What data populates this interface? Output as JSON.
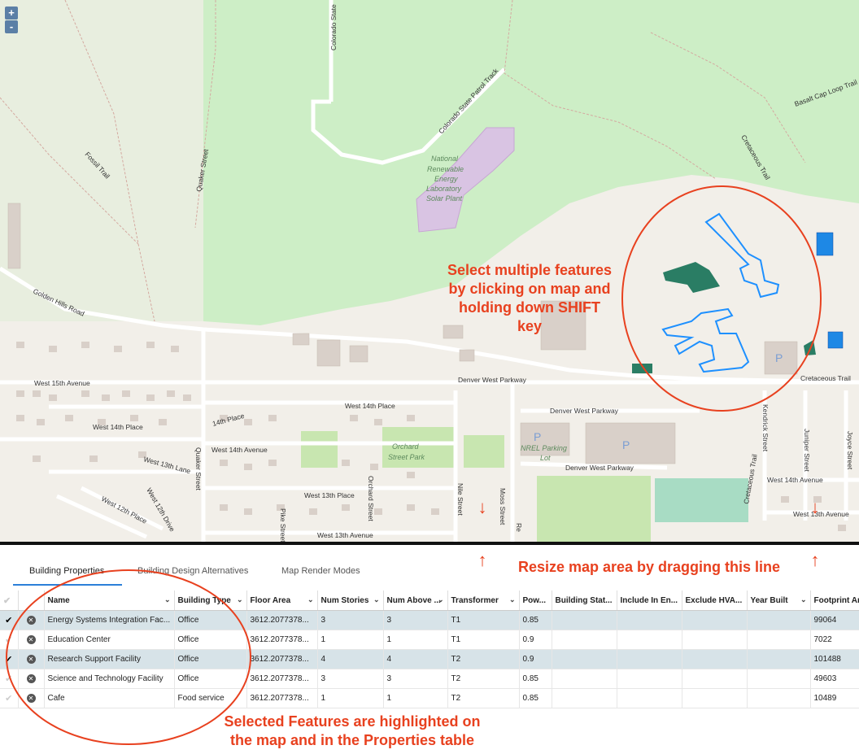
{
  "map": {
    "zoom_in": "+",
    "zoom_out": "-",
    "labels": {
      "colorado_state": "Colorado State",
      "patrol_track": "Colorado State Patrol Track",
      "basalt": "Basalt Cap Loop Trail",
      "cretaceous_trail": "Cretaceous Trail",
      "fossil_trail": "Fossil Trail",
      "quaker_street": "Quaker Street",
      "nrel_line1": "National",
      "nrel_line2": "Renewable",
      "nrel_line3": "Energy",
      "nrel_line4": "Laboratory",
      "nrel_line5": "Solar Plant",
      "golden_hills": "Golden Hills Road",
      "west_15th": "West 15th Avenue",
      "denver_west_pkwy": "Denver West Parkway",
      "cretaceous_trail_2": "Cretaceous Trail",
      "west_14th_place": "West 14th Place",
      "west_14th_place_2": "West 14th Place",
      "fourteenth_place": "14th Place",
      "west_14th_avenue": "West 14th Avenue",
      "west_13th_lane": "West 13th Lane",
      "quaker_street_2": "Quaker Street",
      "west_12th_drive": "West 12th Drive",
      "west_12th_place": "West 12th Place",
      "orchard_park_1": "Orchard",
      "orchard_park_2": "Street Park",
      "orchard_street": "Orchard Street",
      "west_13th_place": "West 13th Place",
      "nile_street": "Nile Street",
      "moss_street": "Moss Street",
      "pike_street": "Pike Street",
      "west_13th_avenue": "West 13th Avenue",
      "dwp_2": "Denver West Parkway",
      "dwp_3": "Denver West Parkway",
      "nrel_parking_1": "NREL Parking",
      "nrel_parking_2": "Lot",
      "parking": "P",
      "kendrick": "Kendrick Street",
      "juniper": "Juniper Street",
      "joyce": "Joyce Street",
      "cretaceous_trail_3": "Cretaceous Trail",
      "west_14th_avenue_2": "West 14th Avenue",
      "west_13th_avenue_2": "West 13th Avenue",
      "re": "Re"
    }
  },
  "annotations": {
    "select_line1": "Select multiple features",
    "select_line2": "by clicking on map and",
    "select_line3": "holding down SHIFT",
    "select_line4": "key",
    "resize": "Resize map area by dragging this line",
    "selected_line1": "Selected Features are highlighted on",
    "selected_line2": "the map and in the Properties table"
  },
  "tabs": {
    "building_properties": "Building Properties",
    "design_alternatives": "Building Design Alternatives",
    "render_modes": "Map Render Modes"
  },
  "table": {
    "columns": [
      "Name",
      "Building Type",
      "Floor Area",
      "Num Stories",
      "Num Above ...",
      "Transformer",
      "Pow...",
      "Building Stat...",
      "Include In En...",
      "Exclude HVA...",
      "Year Built",
      "Footprint Ar"
    ],
    "rows": [
      {
        "selected": true,
        "name": "Energy Systems Integration Fac...",
        "type": "Office",
        "floor_area": "3612.2077378...",
        "stories": "3",
        "above": "3",
        "transformer": "T1",
        "power": "0.85",
        "footprint": "99064"
      },
      {
        "selected": false,
        "name": "Education Center",
        "type": "Office",
        "floor_area": "3612.2077378...",
        "stories": "1",
        "above": "1",
        "transformer": "T1",
        "power": "0.9",
        "footprint": "7022"
      },
      {
        "selected": true,
        "name": "Research Support Facility",
        "type": "Office",
        "floor_area": "3612.2077378...",
        "stories": "4",
        "above": "4",
        "transformer": "T2",
        "power": "0.9",
        "footprint": "101488"
      },
      {
        "selected": false,
        "name": "Science and Technology Facility",
        "type": "Office",
        "floor_area": "3612.2077378...",
        "stories": "3",
        "above": "3",
        "transformer": "T2",
        "power": "0.85",
        "footprint": "49603"
      },
      {
        "selected": false,
        "name": "Cafe",
        "type": "Food service",
        "floor_area": "3612.2077378...",
        "stories": "1",
        "above": "1",
        "transformer": "T2",
        "power": "0.85",
        "footprint": "10489"
      }
    ]
  },
  "icons": {
    "check": "✔",
    "remove": "✕",
    "sort": "⌄"
  },
  "colors": {
    "annotation": "#e8411f",
    "selected_building": "#1e90ff",
    "highlighted_building": "#2a7d64",
    "selected_row": "#d7e3e8",
    "tab_underline": "#2b7fd9",
    "forest": "#cdeec6"
  }
}
